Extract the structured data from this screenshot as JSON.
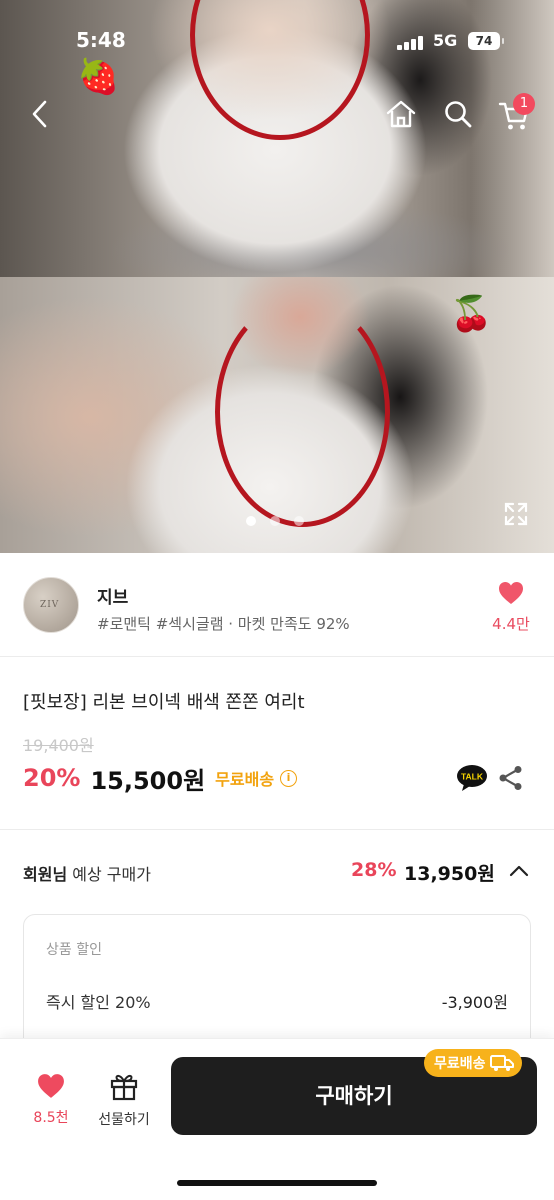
{
  "status_bar": {
    "time": "5:48",
    "network": "5G",
    "battery": "74"
  },
  "top_nav": {
    "cart_badge": "1"
  },
  "gallery": {
    "decorations": [
      "🍓",
      "🍒"
    ],
    "page_count": 3,
    "current_page": 1
  },
  "seller": {
    "avatar_text": "ZIV",
    "name": "지브",
    "meta": "#로맨틱 #섹시글램 · 마켓 만족도 92%",
    "like_count": "4.4만"
  },
  "product": {
    "title": "[핏보장] 리본 브이넥 배색 쫀쫀 여리t",
    "original_price": "19,400원",
    "discount_rate": "20%",
    "price": "15,500원",
    "shipping_label": "무료배송",
    "talk_label": "TALK"
  },
  "member": {
    "label_strong": "회원님",
    "label_rest": " 예상 구매가",
    "discount_rate": "28%",
    "price": "13,950원"
  },
  "discount_box": {
    "header": "상품 할인",
    "items": [
      {
        "name": "즉시 할인 20%",
        "amount": "-3,900원"
      }
    ]
  },
  "bottom_bar": {
    "wish_count": "8.5천",
    "gift_label": "선물하기",
    "buy_label": "구매하기",
    "shipping_badge": "무료배송"
  },
  "colors": {
    "accent_red": "#e9455a",
    "shipping_yellow": "#f2a30f",
    "button_dark": "#1e1e1e"
  }
}
